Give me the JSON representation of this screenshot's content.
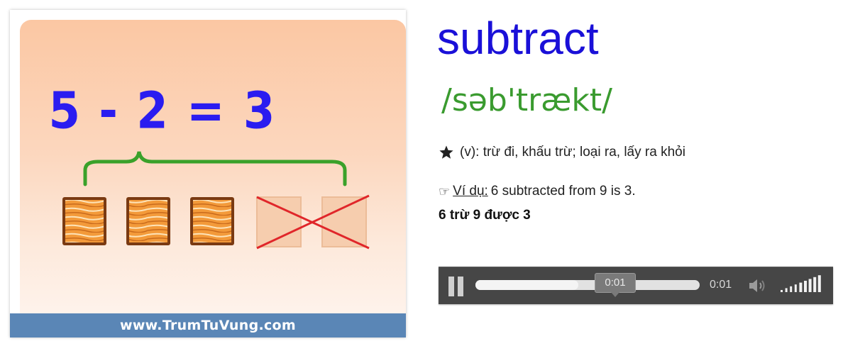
{
  "card": {
    "equation": "5 - 2 = 3",
    "website": "www.TrumTuVung.com",
    "blocks_kept": 3,
    "blocks_removed": 2
  },
  "entry": {
    "word": "subtract",
    "phonetic": "/səb'trækt/",
    "definition": "(v): trừ đi, khấu trừ; loại ra, lấy ra khỏi",
    "example_label": "Ví dụ:",
    "example_text": "6 subtracted from 9 is 3.",
    "translation": "6 trừ 9 được 3"
  },
  "player": {
    "tooltip_time": "0:01",
    "current_time": "0:01",
    "progress": 0.46,
    "volume_level": 1.0
  },
  "colors": {
    "word": "#1a10d8",
    "phonetic": "#3a9b2f",
    "equation": "#2a1cf0",
    "footer": "#5a86b6",
    "player_bg": "#464646"
  }
}
